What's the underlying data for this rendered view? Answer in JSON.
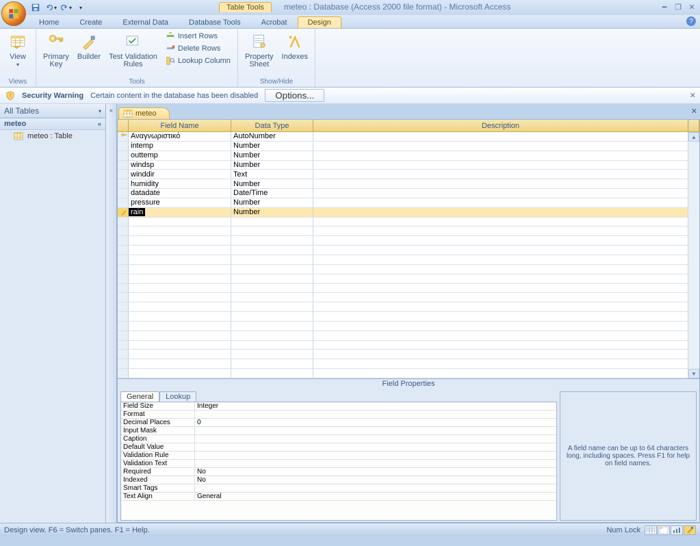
{
  "title": {
    "tabletools": "Table Tools",
    "main": "meteo : Database (Access 2000 file format) - Microsoft Access"
  },
  "tabs": {
    "home": "Home",
    "create": "Create",
    "external": "External Data",
    "dbtools": "Database Tools",
    "acrobat": "Acrobat",
    "design": "Design"
  },
  "ribbon": {
    "views": {
      "view": "View",
      "group": "Views"
    },
    "tools": {
      "primary": "Primary\nKey",
      "builder": "Builder",
      "test": "Test Validation\nRules",
      "insert": "Insert Rows",
      "delete": "Delete Rows",
      "lookup": "Lookup Column",
      "group": "Tools"
    },
    "showhide": {
      "property": "Property\nSheet",
      "indexes": "Indexes",
      "group": "Show/Hide"
    }
  },
  "msgbar": {
    "title": "Security Warning",
    "text": "Certain content in the database has been disabled",
    "button": "Options..."
  },
  "nav": {
    "head": "All Tables",
    "group": "meteo",
    "item": "meteo : Table"
  },
  "doctab": "meteo",
  "gridhead": {
    "field": "Field Name",
    "type": "Data Type",
    "desc": "Description"
  },
  "rows": [
    {
      "field": "Αναγνωριστικό",
      "type": "AutoNumber",
      "pk": true
    },
    {
      "field": "intemp",
      "type": "Number"
    },
    {
      "field": "outtemp",
      "type": "Number"
    },
    {
      "field": "windsp",
      "type": "Number"
    },
    {
      "field": "winddir",
      "type": "Text"
    },
    {
      "field": "humidity",
      "type": "Number"
    },
    {
      "field": "datadate",
      "type": "Date/Time"
    },
    {
      "field": "pressure",
      "type": "Number"
    },
    {
      "field": "rain",
      "type": "Number",
      "editing": true
    }
  ],
  "fieldprops": {
    "title": "Field Properties",
    "tabs": {
      "general": "General",
      "lookup": "Lookup"
    },
    "rows": [
      {
        "lbl": "Field Size",
        "val": "Integer"
      },
      {
        "lbl": "Format",
        "val": ""
      },
      {
        "lbl": "Decimal Places",
        "val": "0"
      },
      {
        "lbl": "Input Mask",
        "val": ""
      },
      {
        "lbl": "Caption",
        "val": ""
      },
      {
        "lbl": "Default Value",
        "val": ""
      },
      {
        "lbl": "Validation Rule",
        "val": ""
      },
      {
        "lbl": "Validation Text",
        "val": ""
      },
      {
        "lbl": "Required",
        "val": "No"
      },
      {
        "lbl": "Indexed",
        "val": "No"
      },
      {
        "lbl": "Smart Tags",
        "val": ""
      },
      {
        "lbl": "Text Align",
        "val": "General"
      }
    ],
    "help": "A field name can be up to 64 characters long, including spaces.  Press F1 for help on field names."
  },
  "status": {
    "left": "Design view.  F6 = Switch panes.  F1 = Help.",
    "numlock": "Num Lock"
  }
}
